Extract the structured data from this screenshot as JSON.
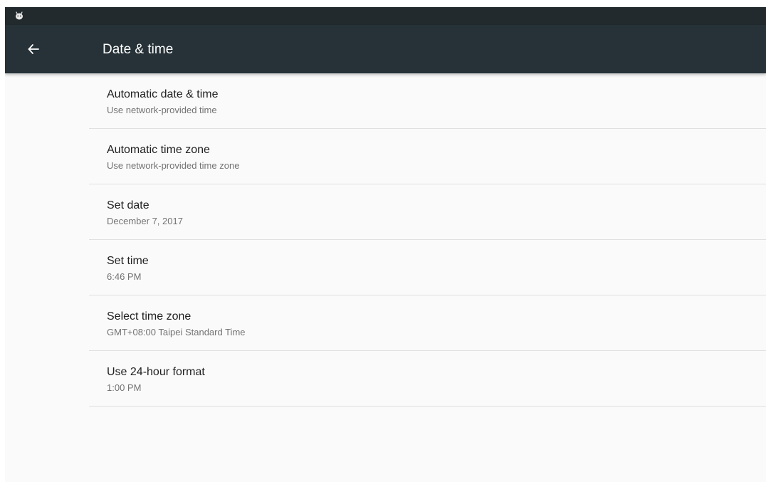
{
  "colors": {
    "status_bar": "#222a2e",
    "app_bar": "#263238",
    "background": "#fafafa",
    "divider": "#e0e0e0",
    "title_text": "#212121",
    "summary_text": "#737373"
  },
  "status_bar": {
    "icon": "android-icon"
  },
  "app_bar": {
    "back_icon": "arrow-back-icon",
    "title": "Date & time"
  },
  "settings": [
    {
      "title": "Automatic date & time",
      "summary": "Use network-provided time"
    },
    {
      "title": "Automatic time zone",
      "summary": "Use network-provided time zone"
    },
    {
      "title": "Set date",
      "summary": "December 7, 2017"
    },
    {
      "title": "Set time",
      "summary": "6:46 PM"
    },
    {
      "title": "Select time zone",
      "summary": "GMT+08:00 Taipei Standard Time"
    },
    {
      "title": "Use 24-hour format",
      "summary": "1:00 PM"
    }
  ]
}
